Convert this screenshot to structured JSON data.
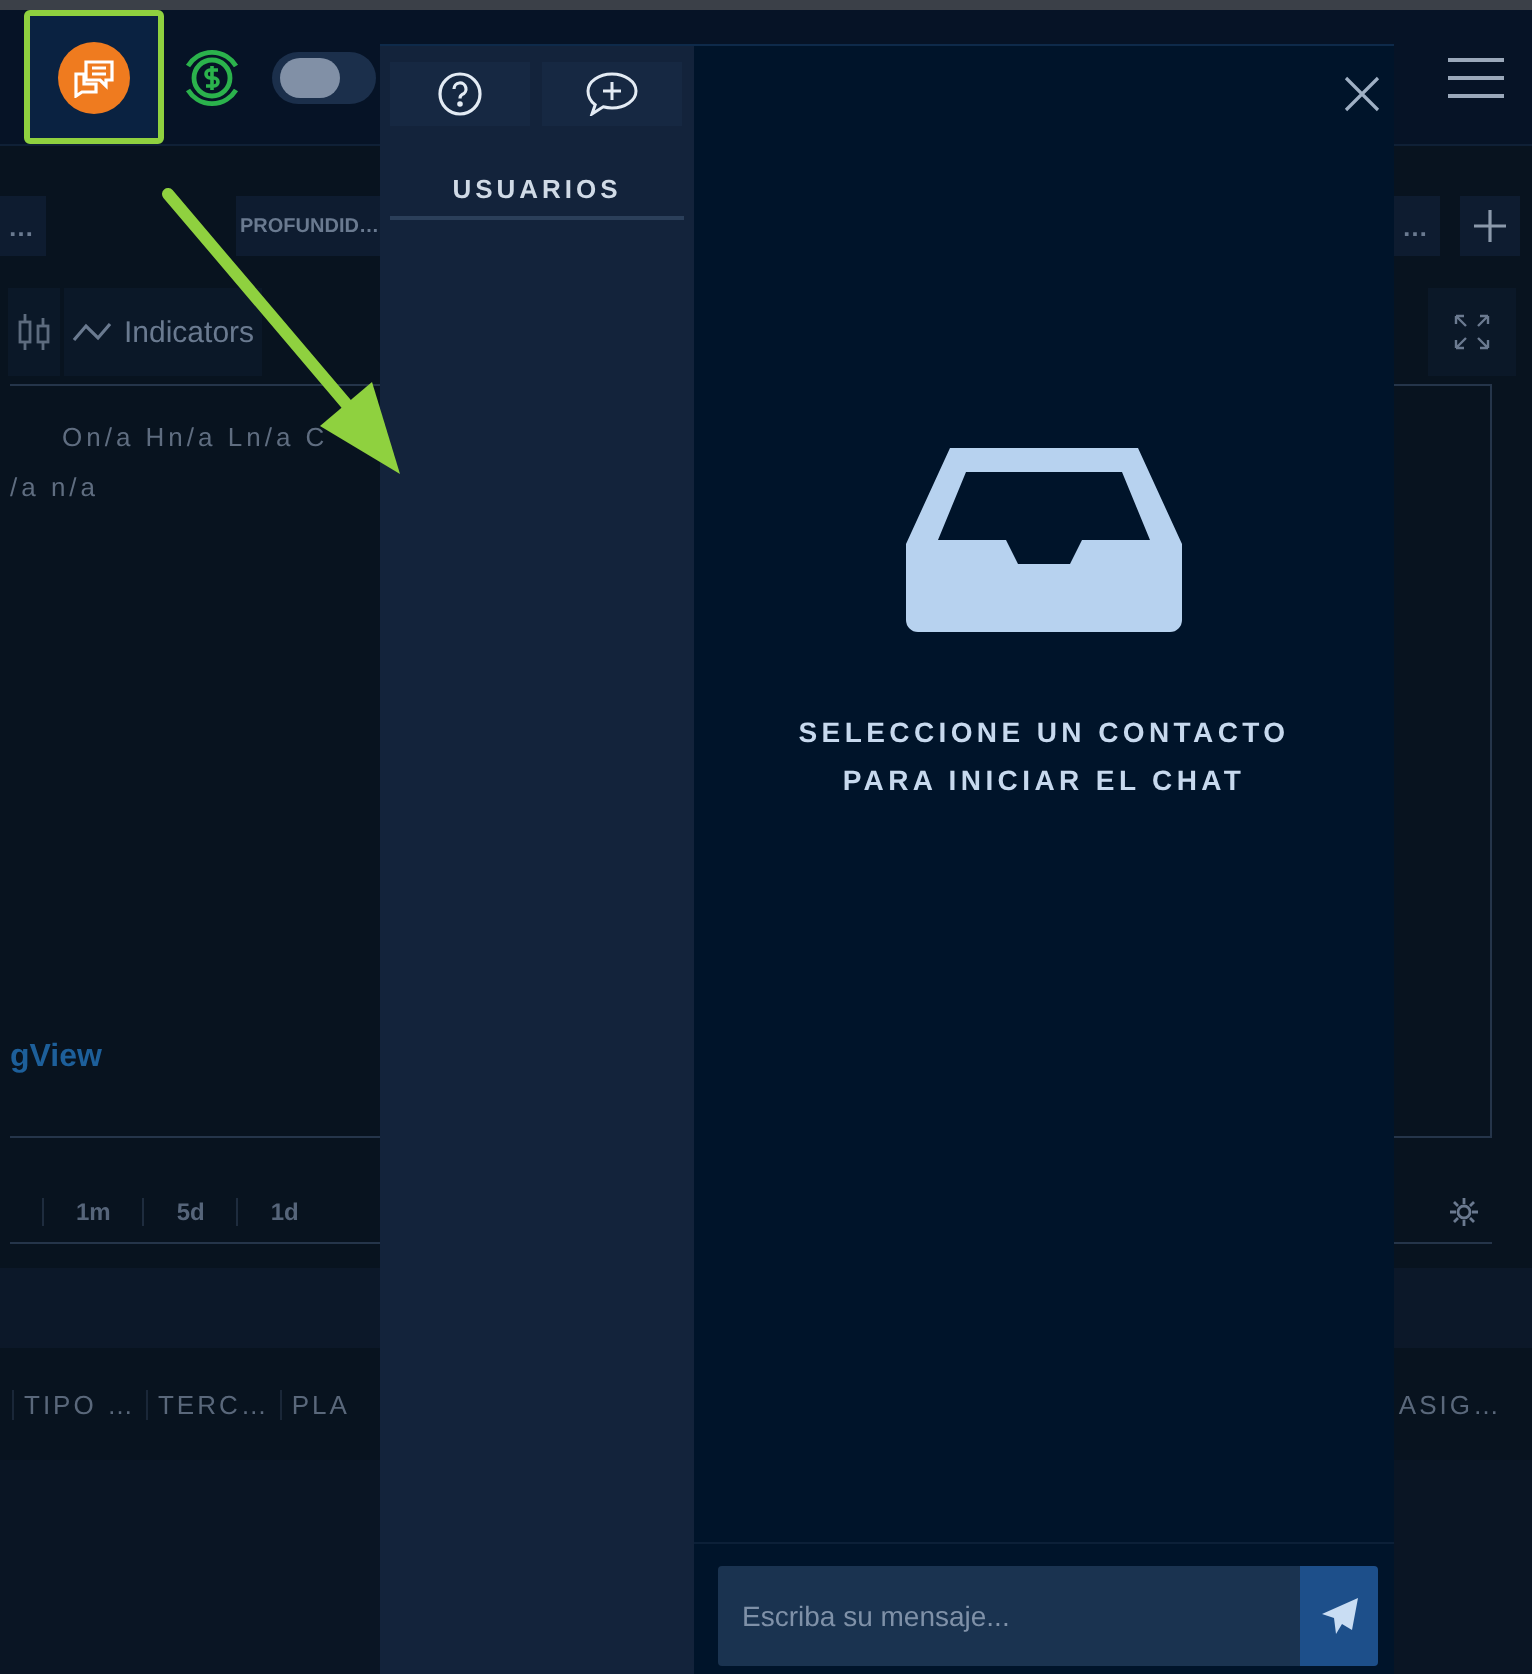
{
  "background_app": {
    "toggle": {
      "on": false
    },
    "tabs": [
      {
        "label": "…"
      },
      {
        "label": "PROFUNDID…"
      },
      {
        "label": "…"
      }
    ],
    "toolbar": {
      "indicators_label": "Indicators"
    },
    "chart": {
      "legend_line_1": "On/a Hn/a Ln/a C",
      "legend_line_2": "/a n/a",
      "watermark_text": "gView"
    },
    "timeframes": [
      "1m",
      "5d",
      "1d"
    ],
    "table": {
      "columns_left": [
        "TIPO …",
        "TERC…",
        "PLA"
      ],
      "columns_right": [
        "ASIG…"
      ]
    }
  },
  "chat_panel": {
    "sidebar": {
      "header": "USUARIOS"
    },
    "empty_state": {
      "line_1": "SELECCIONE UN CONTACTO",
      "line_2": "PARA INICIAR EL CHAT"
    },
    "message_input": {
      "placeholder": "Escriba su mensaje..."
    }
  }
}
